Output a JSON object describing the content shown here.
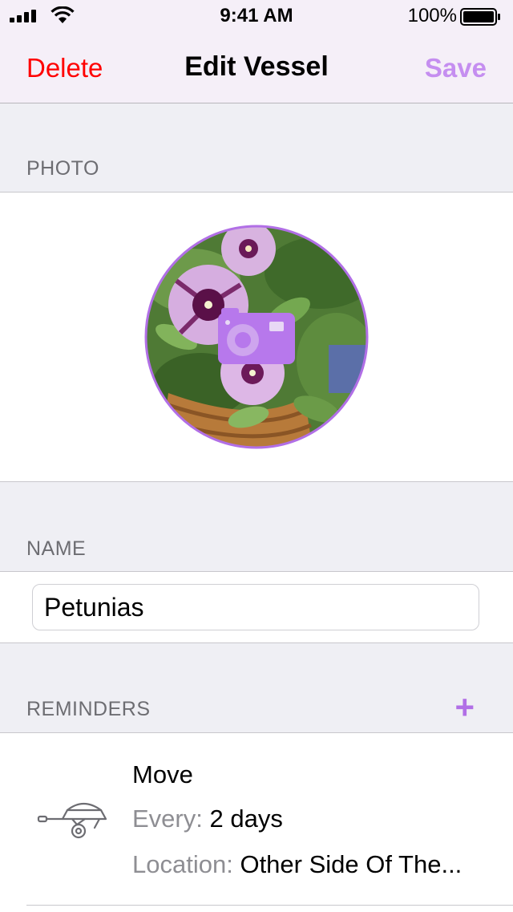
{
  "status_bar": {
    "time": "9:41 AM",
    "battery_percent": "100%"
  },
  "nav": {
    "delete_label": "Delete",
    "title": "Edit Vessel",
    "save_label": "Save"
  },
  "colors": {
    "accent": "#b16fe6",
    "destructive": "#ff0000",
    "save": "#c58ef0",
    "muted": "#8e8e93"
  },
  "photo": {
    "section_label": "PHOTO",
    "overlay_icon": "camera-icon"
  },
  "name": {
    "section_label": "NAME",
    "value": "Petunias"
  },
  "reminders": {
    "section_label": "REMINDERS",
    "add_label": "+",
    "items": [
      {
        "icon": "wheelbarrow-icon",
        "title": "Move",
        "every_label": "Every:",
        "every_value": "2 days",
        "location_label": "Location:",
        "location_value": "Other Side Of The..."
      }
    ]
  }
}
